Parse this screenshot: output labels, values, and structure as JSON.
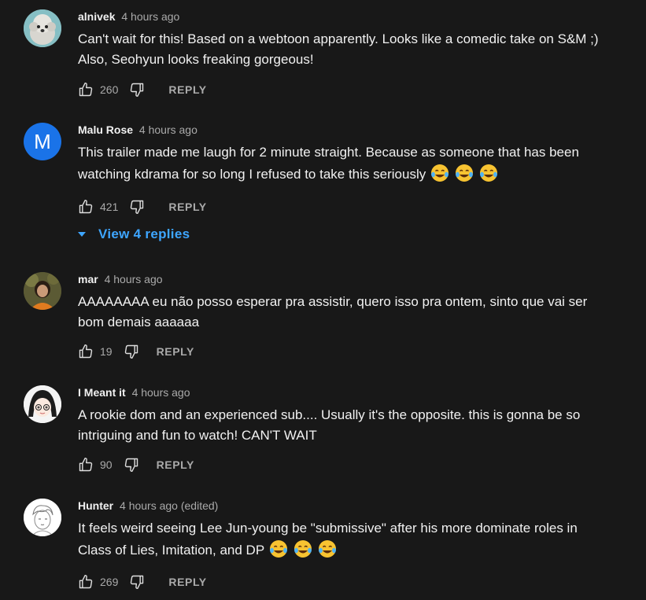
{
  "comments": [
    {
      "author": "alnivek",
      "time": "4 hours ago",
      "lines": [
        "Can't wait for this! Based on a webtoon apparently. Looks like a comedic take on S&M ;)",
        "Also, Seohyun looks freaking gorgeous!"
      ],
      "likes": "260",
      "avatar": "dog-photo"
    },
    {
      "author": "Malu Rose",
      "time": "4 hours ago",
      "lines": [
        "This trailer made me laugh for 2 minute straight. Because as someone that has been",
        "watching kdrama for so long I refused to take this seriously"
      ],
      "likes": "421",
      "avatar_letter": "M",
      "avatar_color": "#1a73e8"
    },
    {
      "author": "mar",
      "time": "4 hours ago",
      "lines": [
        "AAAAAAAA eu não posso esperar pra assistir, quero isso pra ontem, sinto que vai ser",
        "bom demais aaaaaa"
      ],
      "likes": "19",
      "avatar": "person-photo"
    },
    {
      "author": "I Meant it",
      "time": "4 hours ago",
      "lines": [
        "A rookie dom and an experienced sub.... Usually it's the opposite. this is gonna be so",
        "intriguing and fun to watch! CAN'T WAIT"
      ],
      "likes": "90",
      "avatar": "anime-girl"
    },
    {
      "author": "Hunter",
      "time": "4 hours ago (edited)",
      "lines": [
        "It feels weird seeing Lee Jun-young be \"submissive\" after his more dominate roles in",
        "Class of Lies, Imitation, and DP"
      ],
      "likes": "269",
      "avatar": "sketch-drawing"
    }
  ],
  "reply_label": "REPLY",
  "view_replies": "View 4 replies",
  "colors": {
    "background": "#181818",
    "link": "#3ea6ff",
    "secondary": "#aaaaaa"
  },
  "icons": [
    "thumbs-up-icon",
    "thumbs-down-icon",
    "tears-of-joy-emoji",
    "caret-down-icon"
  ]
}
